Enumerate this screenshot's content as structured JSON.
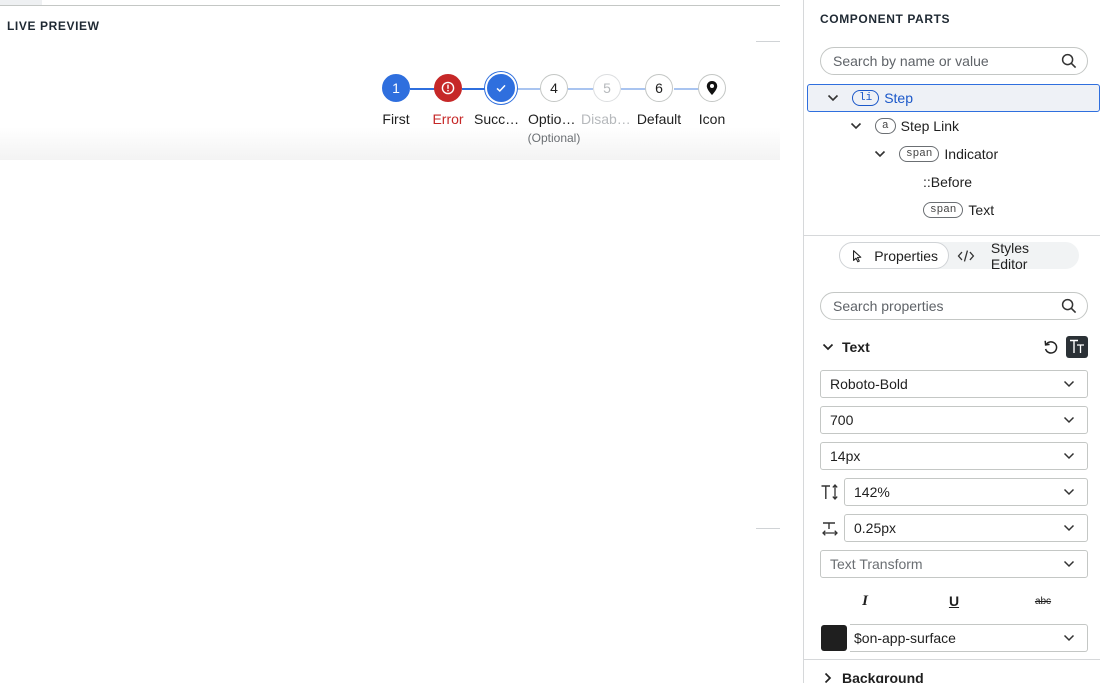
{
  "preview": {
    "title": "LIVE PREVIEW",
    "steps": [
      {
        "indicator": "1",
        "label": "First",
        "state": "primary",
        "sublabel": ""
      },
      {
        "indicator": "error-icon",
        "label": "Error",
        "state": "error",
        "sublabel": ""
      },
      {
        "indicator": "check-icon",
        "label": "Success",
        "state": "success",
        "sublabel": ""
      },
      {
        "indicator": "4",
        "label": "Optional",
        "state": "default",
        "sublabel": "(Optional)"
      },
      {
        "indicator": "5",
        "label": "Disabled",
        "state": "disabled",
        "sublabel": ""
      },
      {
        "indicator": "6",
        "label": "Default",
        "state": "default",
        "sublabel": ""
      },
      {
        "indicator": "location-pin-icon",
        "label": "Icon",
        "state": "default",
        "sublabel": ""
      }
    ],
    "colors": {
      "primary": "#2f6fde",
      "error": "#c62828",
      "disabled": "#b6b9bc",
      "line_done": "#2f6fde",
      "line_todo": "#a9c4f0"
    }
  },
  "panel": {
    "title": "COMPONENT PARTS",
    "parts_search_placeholder": "Search by name or value",
    "tree": [
      {
        "tag": "li",
        "label": "Step",
        "expanded": true,
        "selected": true
      },
      {
        "tag": "a",
        "label": "Step Link",
        "expanded": true,
        "selected": false
      },
      {
        "tag": "span",
        "label": "Indicator",
        "expanded": true,
        "selected": false
      },
      {
        "tag": "",
        "label": "::Before",
        "expanded": false,
        "selected": false
      },
      {
        "tag": "span",
        "label": "Text",
        "expanded": false,
        "selected": false
      }
    ],
    "tabs": {
      "properties": "Properties",
      "styles_editor": "Styles Editor"
    },
    "props_search_placeholder": "Search properties",
    "text_section": {
      "title": "Text",
      "font_family": "Roboto-Bold",
      "font_weight": "700",
      "font_size": "14px",
      "line_height": "142%",
      "letter_spacing": "0.25px",
      "text_transform_placeholder": "Text Transform",
      "italic": "I",
      "underline": "U",
      "strikethrough": "abc",
      "color_value": "$on-app-surface",
      "color_swatch": "#1f1f1f"
    },
    "background_section": {
      "title": "Background"
    }
  }
}
